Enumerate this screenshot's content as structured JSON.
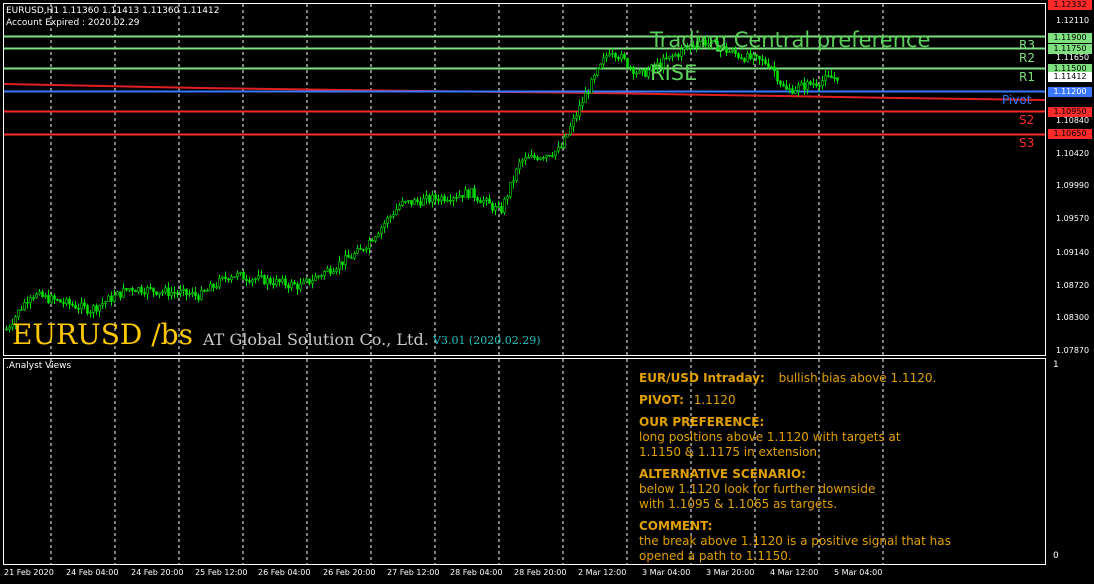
{
  "header": {
    "symbol_line": "EURUSD,H1  1.11360 1.11413 1.11360 1.11412",
    "account_line": "Account Expired : 2020.02.29"
  },
  "brand": {
    "symbol": "EURUSD /bs",
    "company": "AT Global Solution Co., Ltd.",
    "version": "V3.01 (2020.02.29)"
  },
  "overlay": {
    "preference_title": "Trading Central preference",
    "direction": "RISE"
  },
  "levels": [
    {
      "name": "R3",
      "value": 1.119,
      "label": "1.11900",
      "color": "#7ee07e"
    },
    {
      "name": "R2",
      "value": 1.1175,
      "label": "1.11750",
      "color": "#7ee07e"
    },
    {
      "name": "R1",
      "value": 1.115,
      "label": "1.11500",
      "color": "#7ee07e"
    },
    {
      "name": "Pivot",
      "value": 1.112,
      "label": "1.11200",
      "color": "#3a78ff"
    },
    {
      "name": "S2",
      "value": 1.1095,
      "label": "1.10950",
      "color": "#ff2a2a"
    },
    {
      "name": "S3",
      "value": 1.1065,
      "label": "1.10650",
      "color": "#ff2a2a"
    }
  ],
  "price_axis": {
    "top_tag": "1.12332",
    "current_tag": "1.11412",
    "ticks": [
      "1.12110",
      "1.11650",
      "1.10840",
      "1.10420",
      "1.09990",
      "1.09570",
      "1.09140",
      "1.08720",
      "1.08300",
      "1.07870"
    ]
  },
  "time_axis": [
    "21 Feb 2020",
    "24 Feb 04:00",
    "24 Feb 20:00",
    "25 Feb 12:00",
    "26 Feb 04:00",
    "26 Feb 20:00",
    "27 Feb 12:00",
    "28 Feb 04:00",
    "28 Feb 20:00",
    "2 Mar 12:00",
    "3 Mar 04:00",
    "3 Mar 20:00",
    "4 Mar 12:00",
    "5 Mar 04:00"
  ],
  "indicator": {
    "name": ".Analyst Views",
    "scale_top": "1",
    "scale_bottom": "0"
  },
  "analysis": {
    "title": "EUR/USD Intraday:",
    "bias": "bullish bias above 1.1120.",
    "pivot_label": "PIVOT:",
    "pivot_value": "1.1120",
    "pref_heading": "OUR PREFERENCE:",
    "pref_line1": "long positions above 1.1120 with targets at",
    "pref_line2": "1.1150 & 1.1175 in extension.",
    "alt_heading": "ALTERNATIVE SCENARIO:",
    "alt_line1": "below 1.1120 look for further downside",
    "alt_line2": "with 1.1095 & 1.1065 as targets.",
    "comment_heading": "COMMENT:",
    "comment_line1": "the break above 1.1120 is a positive signal that has",
    "comment_line2": "opened a path to 1.1150."
  },
  "colors": {
    "candle": "#00e000",
    "grid": "#ffffff",
    "brand_yellow": "#ffc800",
    "company_gray": "#c8c8c8",
    "version_cyan": "#20c0c0",
    "overlay_green": "#5ad05a",
    "note_orange": "#e0a000"
  }
}
